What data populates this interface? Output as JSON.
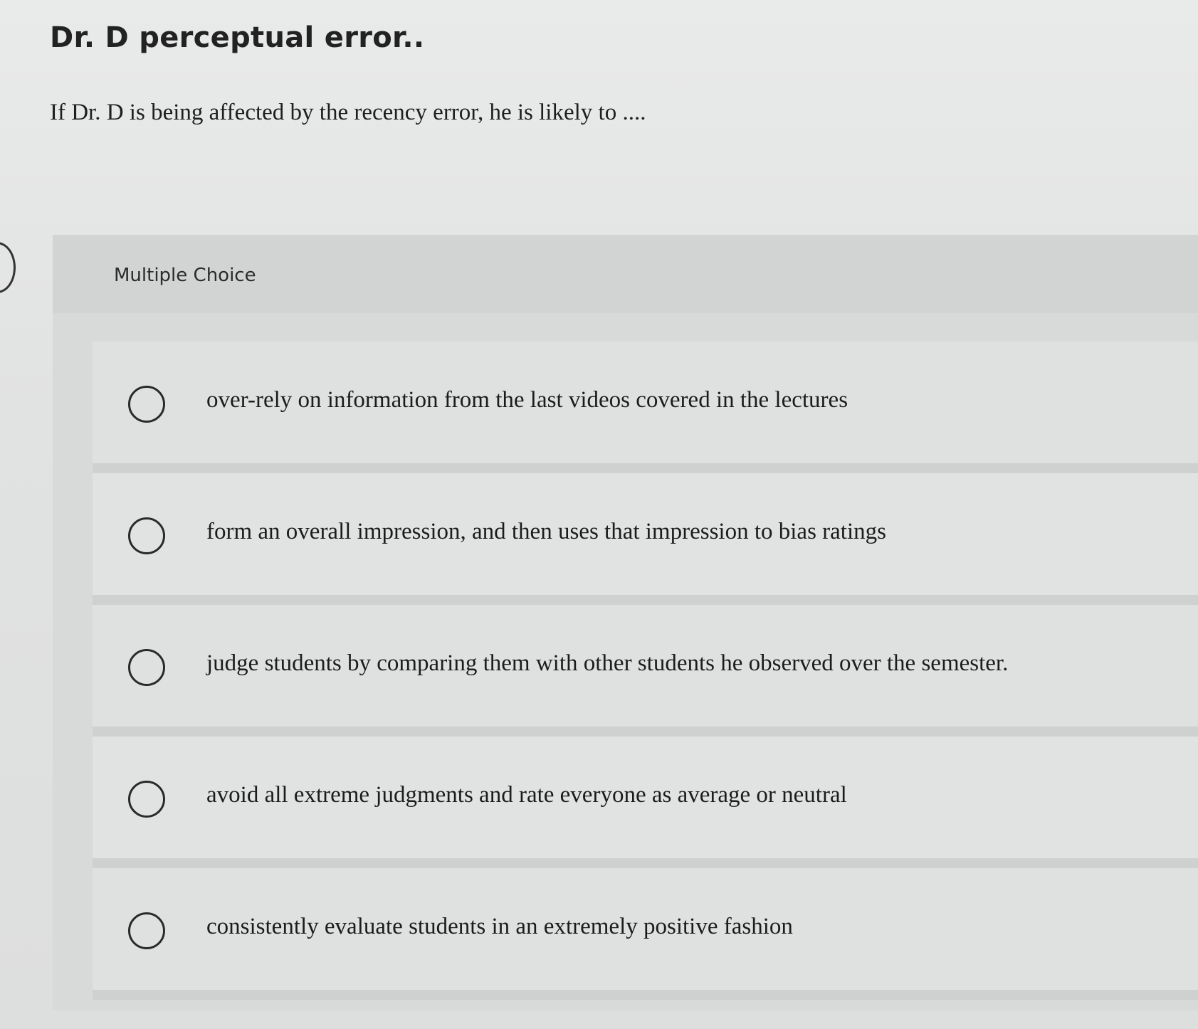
{
  "question": {
    "title": "Dr. D perceptual error..",
    "prompt": "If Dr. D is being affected by the recency error, he is likely to ...."
  },
  "answer_panel": {
    "label": "Multiple Choice",
    "choices": [
      {
        "text": "over-rely on information from the last videos covered in the lectures",
        "selected": false
      },
      {
        "text": "form an overall impression, and then uses that impression to bias ratings",
        "selected": false
      },
      {
        "text": "judge students by comparing them with other students he observed over the semester.",
        "selected": false
      },
      {
        "text": "avoid all extreme judgments and rate everyone as average or neutral",
        "selected": false
      },
      {
        "text": "consistently evaluate students in an extremely positive fashion",
        "selected": false
      }
    ]
  }
}
